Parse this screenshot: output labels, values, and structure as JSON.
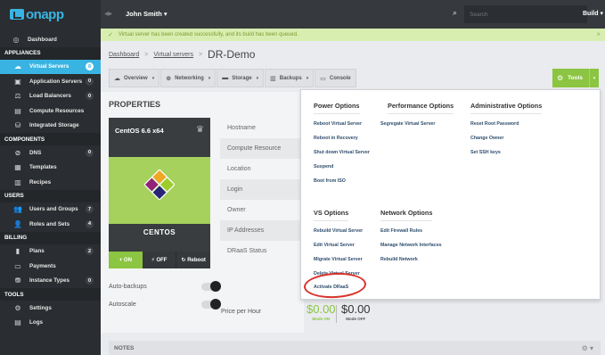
{
  "app": {
    "logo": "onapp",
    "user": "John Smith",
    "build_label": "Build"
  },
  "search": {
    "placeholder": "Search"
  },
  "banner": {
    "message": "Virtual server has been created successfully, and its build has been queued."
  },
  "sidebar": {
    "dashboard": "Dashboard",
    "sections": {
      "appliances": "APPLIANCES",
      "components": "COMPONENTS",
      "users": "USERS",
      "billing": "BILLING",
      "tools": "TOOLS"
    },
    "appliances": [
      {
        "label": "Virtual Servers",
        "count": "8",
        "icon": "cloud-icon"
      },
      {
        "label": "Application Servers",
        "count": "0",
        "icon": "window-icon"
      },
      {
        "label": "Load Balancers",
        "count": "0",
        "icon": "balance-icon"
      },
      {
        "label": "Compute Resources",
        "icon": "server-icon"
      },
      {
        "label": "Integrated Storage",
        "icon": "storage-icon"
      }
    ],
    "components": [
      {
        "label": "DNS",
        "count": "0",
        "icon": "dns-icon"
      },
      {
        "label": "Templates",
        "icon": "templates-icon"
      },
      {
        "label": "Recipes",
        "icon": "recipes-icon"
      }
    ],
    "users": [
      {
        "label": "Users and Groups",
        "count": "7",
        "icon": "users-icon"
      },
      {
        "label": "Roles and Sets",
        "count": "4",
        "icon": "roles-icon"
      }
    ],
    "billing": [
      {
        "label": "Plans",
        "count": "2",
        "icon": "plans-icon"
      },
      {
        "label": "Payments",
        "icon": "payments-icon"
      },
      {
        "label": "Instance Types",
        "count": "0",
        "icon": "instance-icon"
      }
    ],
    "tools": [
      {
        "label": "Settings",
        "icon": "settings-icon"
      },
      {
        "label": "Logs",
        "icon": "logs-icon"
      }
    ]
  },
  "breadcrumb": {
    "dashboard": "Dashboard",
    "virtual_servers": "Virtual servers",
    "current": "DR-Demo"
  },
  "toolbar": {
    "overview": "Overview",
    "networking": "Networking",
    "storage": "Storage",
    "backups": "Backups",
    "console": "Console",
    "tools": "Tools"
  },
  "properties": {
    "title": "PROPERTIES",
    "os_name": "CentOS 6.6 x64",
    "os_label": "CENTOS",
    "power": {
      "on": "ON",
      "off": "OFF",
      "reboot": "Reboot"
    },
    "auto_backups": "Auto-backups",
    "autoscale": "Autoscale",
    "rows": [
      "Hostname",
      "Compute Resource",
      "Location",
      "Login",
      "Owner",
      "IP Addresses",
      "DRaaS Status"
    ],
    "price_label": "Price per Hour",
    "price_on": "$0.00",
    "price_on_label": "Mode ON",
    "price_off": "$0.00",
    "price_off_label": "Mode OFF"
  },
  "notes": {
    "title": "NOTES"
  },
  "tools_menu": {
    "power_options": {
      "title": "Power Options",
      "items": [
        "Reboot Virtual Server",
        "Reboot in Recovery",
        "Shut down Virtual Server",
        "Suspend",
        "Boot from ISO"
      ]
    },
    "performance_options": {
      "title": "Performance Options",
      "items": [
        "Segregate Virtual Server"
      ]
    },
    "administrative_options": {
      "title": "Administrative Options",
      "items": [
        "Reset Root Password",
        "Change Owner",
        "Set SSH keys"
      ]
    },
    "vs_options": {
      "title": "VS Options",
      "items": [
        "Rebuild Virtual Server",
        "Edit Virtual Server",
        "Migrate Virtual Server",
        "Delete Virtual Server",
        "Activate DRaaS"
      ]
    },
    "network_options": {
      "title": "Network Options",
      "items": [
        "Edit Firewall Rules",
        "Manage Network Interfaces",
        "Rebuild Network"
      ]
    }
  },
  "colors": {
    "accent": "#39b4e2",
    "green": "#8bc541",
    "sidebar": "#2a2d31",
    "highlight_circle": "#d9312b"
  }
}
